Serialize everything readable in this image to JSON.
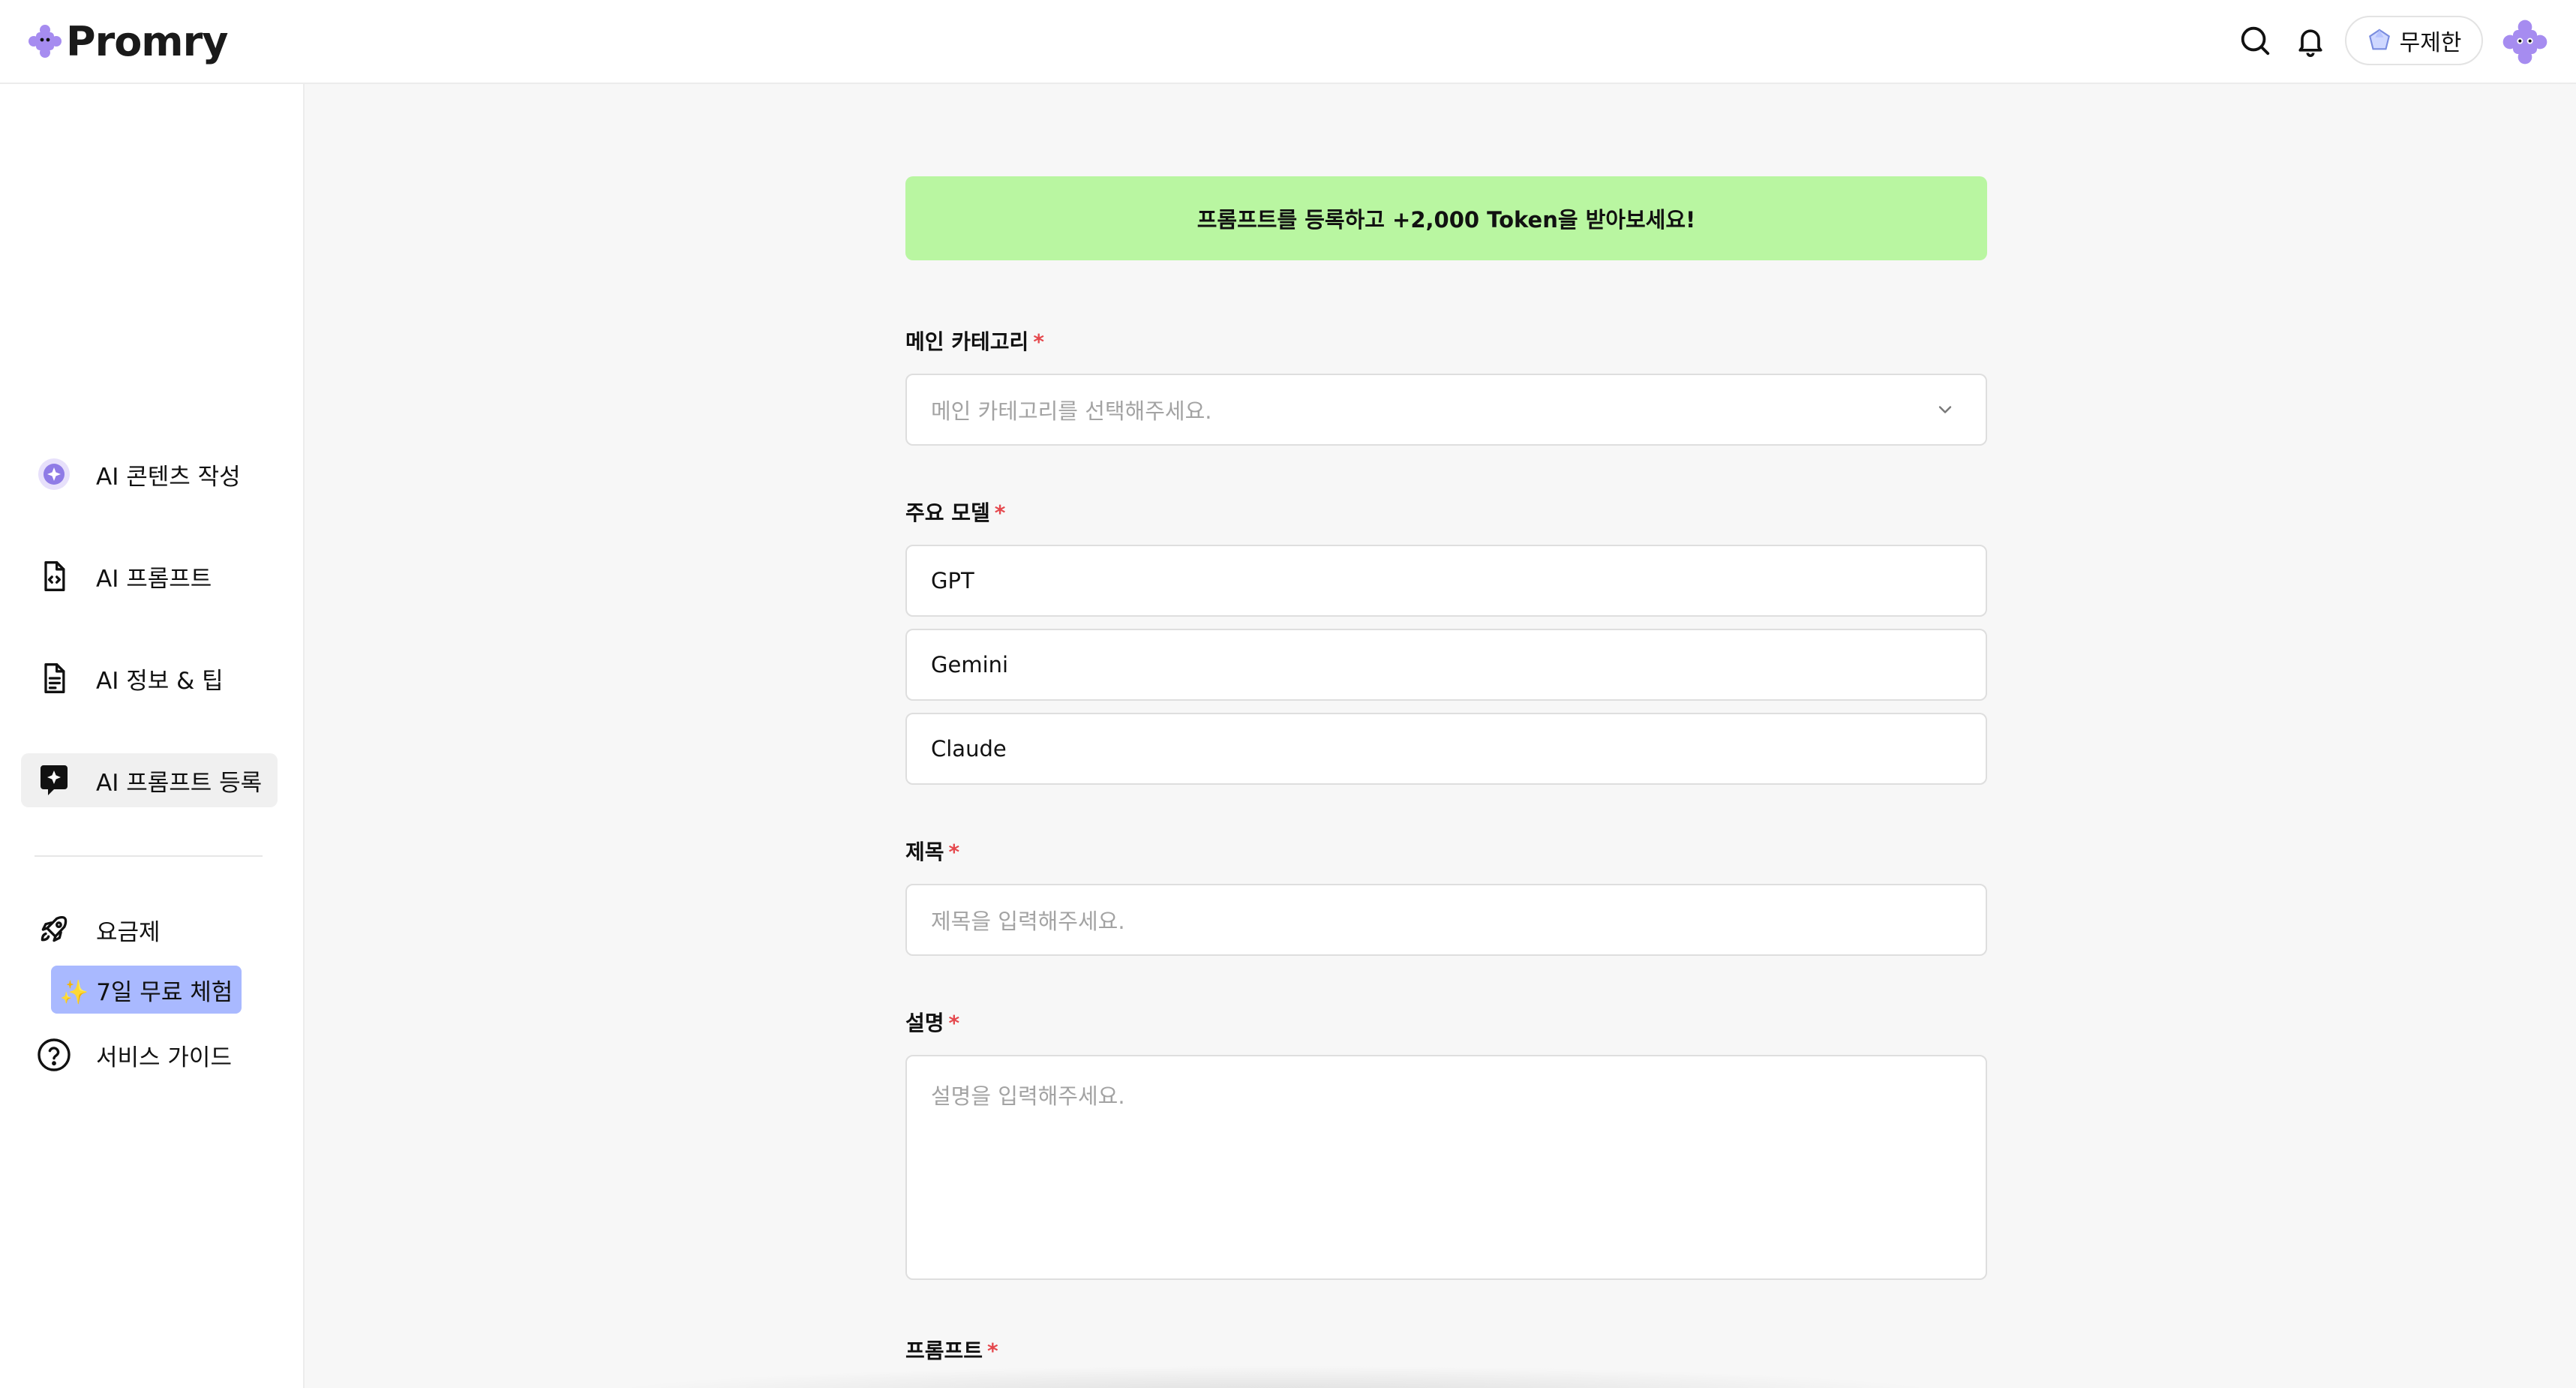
{
  "app": {
    "name": "Promry"
  },
  "header": {
    "search_icon": "search-icon",
    "bell_icon": "bell-icon",
    "plan_label": "무제한",
    "avatar_icon": "puzzle-avatar-icon"
  },
  "sidebar": {
    "items": [
      {
        "label": "AI 콘텐츠 작성",
        "icon": "content-write-icon"
      },
      {
        "label": "AI 프롬프트",
        "icon": "code-file-icon"
      },
      {
        "label": "AI 정보 & 팁",
        "icon": "document-icon"
      },
      {
        "label": "AI 프롬프트 등록",
        "icon": "sparkle-chat-icon",
        "active": true
      },
      {
        "label": "요금제",
        "icon": "rocket-icon"
      },
      {
        "label": "서비스 가이드",
        "icon": "help-circle-icon"
      }
    ],
    "trial_badge": "✨ 7일 무료 체험"
  },
  "form": {
    "banner": "프롬프트를 등록하고 +2,000 Token을 받아보세요!",
    "category": {
      "label": "메인 카테고리",
      "required_mark": "*",
      "placeholder": "메인 카테고리를 선택해주세요."
    },
    "models": {
      "label": "주요 모델",
      "required_mark": "*",
      "options": [
        "GPT",
        "Gemini",
        "Claude"
      ]
    },
    "title": {
      "label": "제목",
      "required_mark": "*",
      "placeholder": "제목을 입력해주세요."
    },
    "description": {
      "label": "설명",
      "required_mark": "*",
      "placeholder": "설명을 입력해주세요."
    },
    "prompt": {
      "label": "프롬프트",
      "required_mark": "*"
    }
  },
  "colors": {
    "banner_bg": "#b9f6a1",
    "required": "#e5484d",
    "trial_bg": "#a9b9ff",
    "brand": "#a68cf0"
  }
}
